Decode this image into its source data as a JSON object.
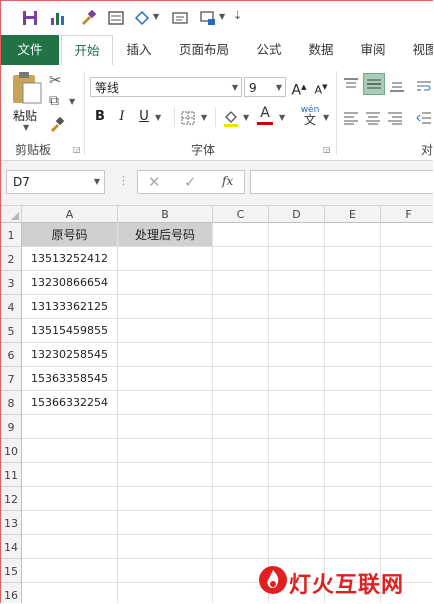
{
  "ribbon_tabs": [
    "文件",
    "开始",
    "插入",
    "页面布局",
    "公式",
    "数据",
    "审阅",
    "视图"
  ],
  "active_tab": "开始",
  "font": {
    "name": "等线",
    "size": "9"
  },
  "groups": {
    "clipboard": "剪贴板",
    "font": "字体",
    "alignment_partial": "对"
  },
  "clipboard": {
    "paste_label": "粘贴"
  },
  "formula_bar": {
    "name_box": "D7",
    "fx": "fx",
    "value": ""
  },
  "columns": [
    "A",
    "B",
    "C",
    "D",
    "E",
    "F"
  ],
  "rows": [
    "1",
    "2",
    "3",
    "4",
    "5",
    "6",
    "7",
    "8",
    "9",
    "10",
    "11",
    "12",
    "13",
    "14",
    "15",
    "16"
  ],
  "table": {
    "headers": [
      "原号码",
      "处理后号码"
    ],
    "values": [
      "13513252412",
      "13230866654",
      "13133362125",
      "13515459855",
      "13230258545",
      "15363358545",
      "15366332254"
    ]
  },
  "watermark": "灯火互联网",
  "colors": {
    "accent": "#217346",
    "header_fill": "#d0d0d0",
    "watermark": "#e02020"
  }
}
